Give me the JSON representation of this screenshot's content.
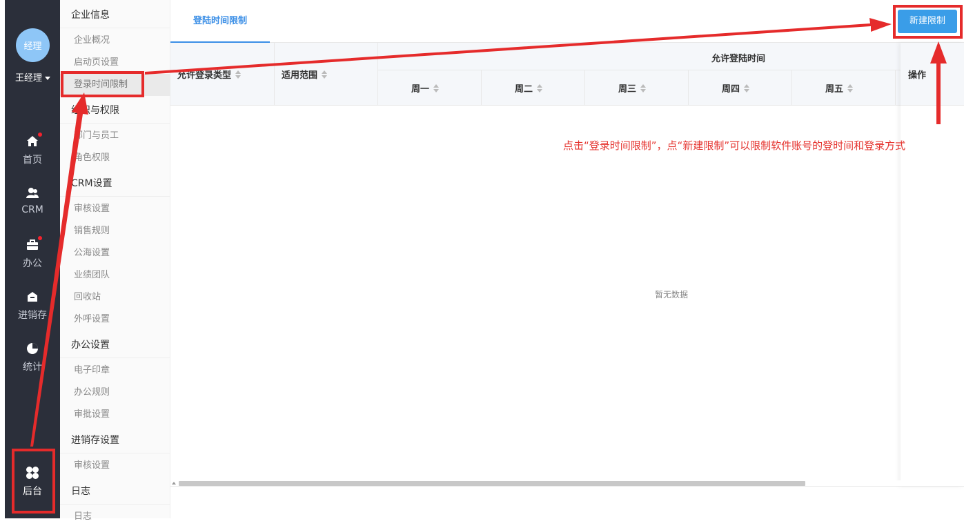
{
  "colors": {
    "accent": "#3a8ee6",
    "button_bg": "#3a9de8",
    "annotation_red": "#e52b2b",
    "rail_bg": "#2b2f3a"
  },
  "rail": {
    "avatar_text": "经理",
    "username": "王经理",
    "items": [
      {
        "label": "首页",
        "icon": "home-icon"
      },
      {
        "label": "CRM",
        "icon": "users-icon"
      },
      {
        "label": "办公",
        "icon": "briefcase-icon"
      },
      {
        "label": "进销存",
        "icon": "store-icon"
      },
      {
        "label": "统计",
        "icon": "pie-chart-icon"
      },
      {
        "label": "后台",
        "icon": "grid-icon"
      }
    ]
  },
  "submenu": {
    "groups": [
      {
        "title": "企业信息",
        "items": [
          "企业概况",
          "启动页设置",
          "登录时间限制"
        ]
      },
      {
        "title": "组织与权限",
        "items": [
          "部门与员工",
          "角色权限"
        ]
      },
      {
        "title": "CRM设置",
        "items": [
          "审核设置",
          "销售规则",
          "公海设置",
          "业绩团队",
          "回收站",
          "外呼设置"
        ]
      },
      {
        "title": "办公设置",
        "items": [
          "电子印章",
          "办公规则",
          "审批设置"
        ]
      },
      {
        "title": "进销存设置",
        "items": [
          "审核设置"
        ]
      },
      {
        "title": "日志",
        "items": [
          "日志"
        ]
      }
    ]
  },
  "main": {
    "tab": "登陆时间限制",
    "new_button": "新建限制",
    "columns": {
      "login_type": "允许登录类型",
      "scope": "适用范围",
      "allowed_time": "允许登陆时间",
      "days": [
        "周一",
        "周二",
        "周三",
        "周四",
        "周五"
      ],
      "ops": "操作"
    },
    "empty_text": "暂无数据"
  },
  "annotation": {
    "text": "点击“登录时间限制”，点“新建限制”可以限制软件账号的登时间和登录方式"
  }
}
